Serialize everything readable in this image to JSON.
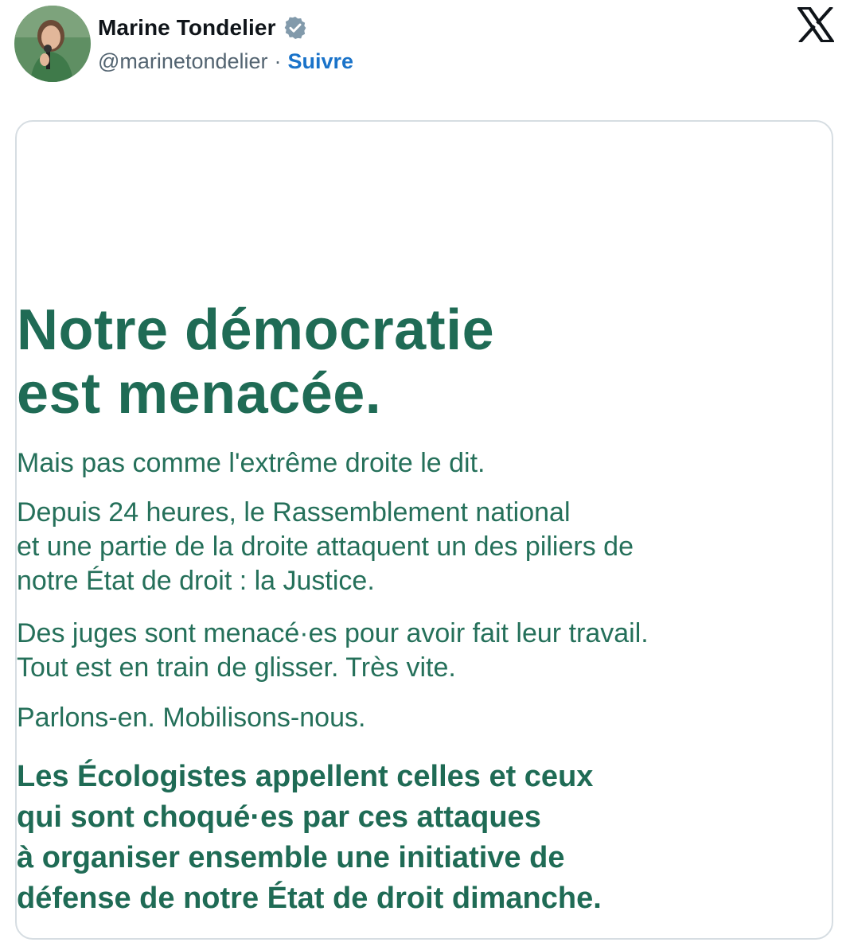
{
  "author": {
    "name": "Marine Tondelier",
    "handle": "@marinetondelier",
    "separator": "·",
    "follow_label": "Suivre",
    "verified_icon": "verified-badge-icon",
    "avatar_icon": "profile-photo"
  },
  "platform": {
    "logo": "x-logo-icon"
  },
  "post_image": {
    "headline": [
      "Notre démocratie",
      "est menacée."
    ],
    "paragraph1": [
      "Mais pas comme l'extrême droite le dit."
    ],
    "paragraph2": [
      "Depuis 24 heures, le Rassemblement national",
      "et une partie de la droite attaquent un des piliers de",
      "notre État de droit : la Justice."
    ],
    "paragraph3": [
      "Des juges sont menacé·es pour avoir fait leur travail.",
      "Tout est en train de glisser. Très vite."
    ],
    "paragraph4": [
      "Parlons-en. Mobilisons-nous."
    ],
    "callout": [
      "Les Écologistes appellent celles et ceux",
      "qui sont choqué·es par ces attaques",
      "à organiser ensemble une initiative de",
      "défense de notre État de droit dimanche."
    ]
  },
  "colors": {
    "text_green": "#1f6b55",
    "link_blue": "#1a73c9",
    "card_border": "#d6dde2"
  }
}
